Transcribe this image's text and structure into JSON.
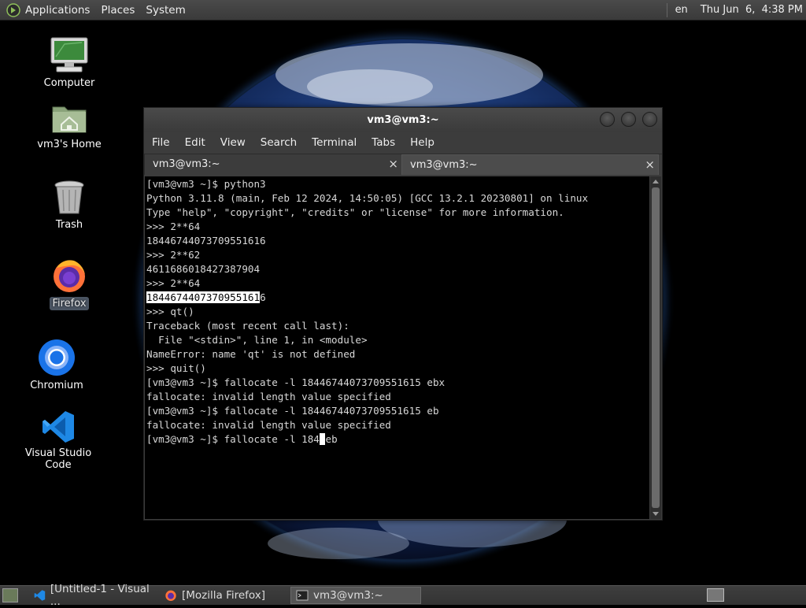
{
  "top_panel": {
    "menus": [
      "Applications",
      "Places",
      "System"
    ],
    "language": "en",
    "clock": "Thu Jun  6,  4:38 PM"
  },
  "desktop_icons": [
    {
      "label": "Computer",
      "icon": "computer-icon"
    },
    {
      "label": "vm3's Home",
      "icon": "home-folder-icon"
    },
    {
      "label": "Trash",
      "icon": "trash-icon"
    },
    {
      "label": "Firefox",
      "icon": "firefox-icon"
    },
    {
      "label": "Chromium",
      "icon": "chromium-icon"
    },
    {
      "label": "Visual Studio Code",
      "icon": "vscode-icon"
    }
  ],
  "window": {
    "title": "vm3@vm3:~",
    "menu": [
      "File",
      "Edit",
      "View",
      "Search",
      "Terminal",
      "Tabs",
      "Help"
    ],
    "tabs": [
      {
        "label": "vm3@vm3:~",
        "close": "×"
      },
      {
        "label": "vm3@vm3:~",
        "close": "×"
      }
    ],
    "terminal": {
      "lines_before": [
        "[vm3@vm3 ~]$ python3",
        "Python 3.11.8 (main, Feb 12 2024, 14:50:05) [GCC 13.2.1 20230801] on linux",
        "Type \"help\", \"copyright\", \"credits\" or \"license\" for more information.",
        ">>> 2**64",
        "18446744073709551616",
        ">>> 2**62",
        "4611686018427387904",
        ">>> 2**64"
      ],
      "selected_text": "1844674407370955161",
      "selected_rest": "6",
      "lines_after": [
        ">>> qt()",
        "Traceback (most recent call last):",
        "  File \"<stdin>\", line 1, in <module>",
        "NameError: name 'qt' is not defined",
        ">>> quit()",
        "[vm3@vm3 ~]$ fallocate -l 18446744073709551615 ebx",
        "fallocate: invalid length value specified",
        "[vm3@vm3 ~]$ fallocate -l 18446744073709551615 eb",
        "fallocate: invalid length value specified"
      ],
      "prompt_before_cursor": "[vm3@vm3 ~]$ fallocate -l 184",
      "prompt_after_cursor": "eb"
    }
  },
  "taskbar": {
    "tasks": [
      {
        "label": "[Untitled-1 - Visual ...",
        "icon": "vscode-icon"
      },
      {
        "label": "[Mozilla Firefox]",
        "icon": "firefox-icon"
      },
      {
        "label": "vm3@vm3:~",
        "icon": "terminal-icon"
      }
    ]
  }
}
